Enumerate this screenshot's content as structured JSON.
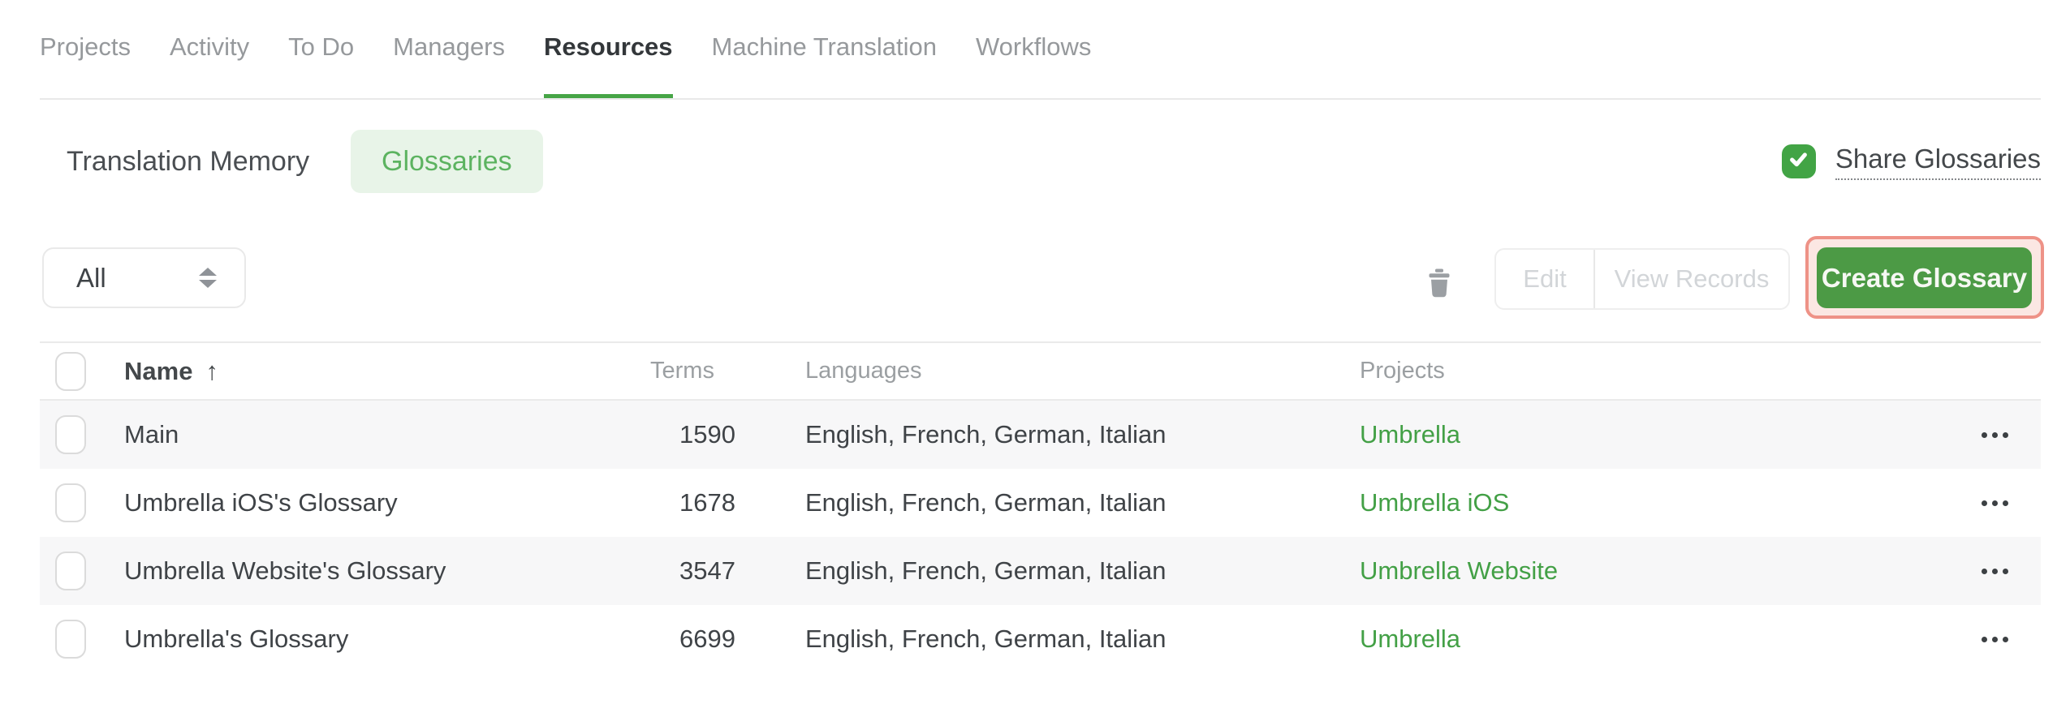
{
  "nav": {
    "tabs": [
      {
        "label": "Projects"
      },
      {
        "label": "Activity"
      },
      {
        "label": "To Do"
      },
      {
        "label": "Managers"
      },
      {
        "label": "Resources"
      },
      {
        "label": "Machine Translation"
      },
      {
        "label": "Workflows"
      }
    ],
    "active_tab": "Resources"
  },
  "subnav": {
    "translation_memory": "Translation Memory",
    "glossaries": "Glossaries",
    "active": "Glossaries"
  },
  "share": {
    "label": "Share Glossaries",
    "checked": true
  },
  "toolbar": {
    "filter_selected": "All",
    "edit": "Edit",
    "view_records": "View Records",
    "create": "Create Glossary"
  },
  "table": {
    "headers": {
      "name": "Name",
      "terms": "Terms",
      "languages": "Languages",
      "projects": "Projects"
    },
    "sort": {
      "column": "Name",
      "direction": "ascending",
      "indicator": "↑"
    },
    "rows": [
      {
        "name": "Main",
        "terms": "1590",
        "languages": "English, French, German, Italian",
        "project": "Umbrella"
      },
      {
        "name": "Umbrella iOS's Glossary",
        "terms": "1678",
        "languages": "English, French, German, Italian",
        "project": "Umbrella iOS"
      },
      {
        "name": "Umbrella Website's Glossary",
        "terms": "3547",
        "languages": "English, French, German, Italian",
        "project": "Umbrella Website"
      },
      {
        "name": "Umbrella's Glossary",
        "terms": "6699",
        "languages": "English, French, German, Italian",
        "project": "Umbrella"
      }
    ]
  },
  "colors": {
    "accent_green": "#46A546",
    "link_green": "#43A046",
    "button_green": "#4C9A45",
    "pill_bg": "#E8F4E8",
    "pill_text": "#5CB360",
    "checkbox_green": "#42A445",
    "highlight_pink_border": "#EE9287",
    "highlight_pink_bg": "#FBE7E3",
    "row_stripe": "#F7F7F8",
    "disabled_text": "#d2d5d8"
  }
}
